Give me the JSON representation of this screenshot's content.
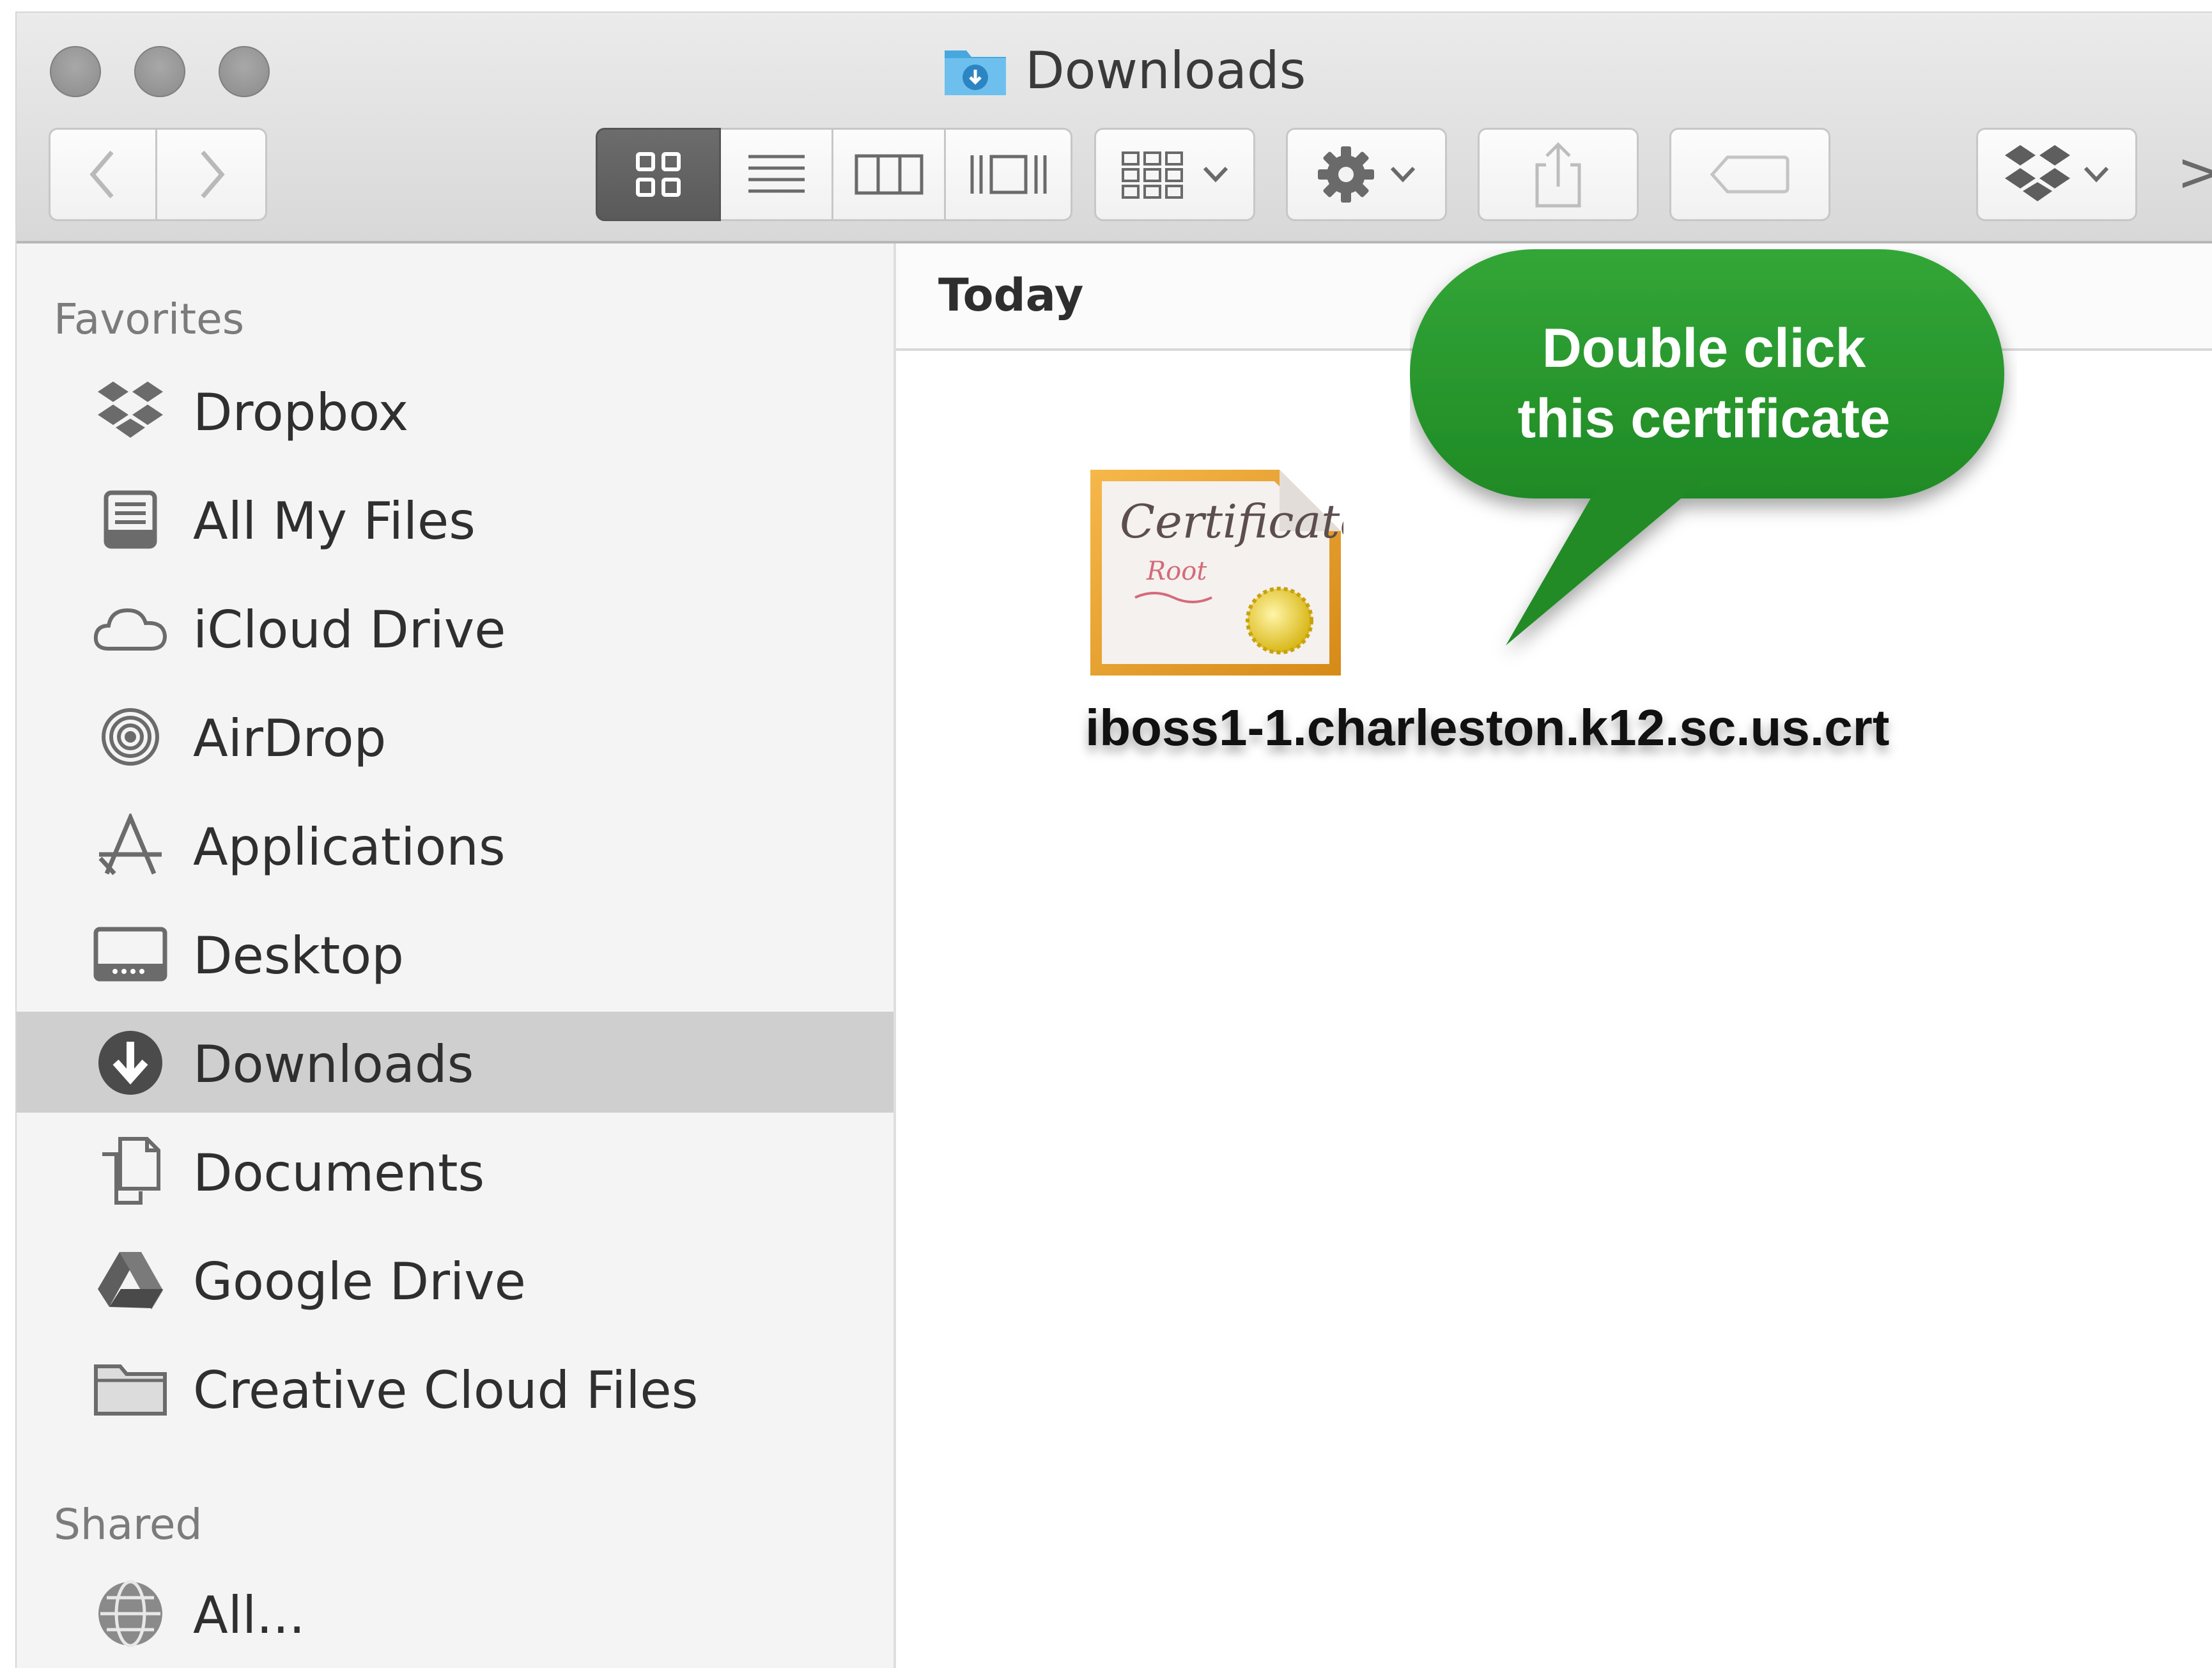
{
  "window": {
    "title": "Downloads"
  },
  "toolbar": {
    "back_icon": "chevron-left-icon",
    "forward_icon": "chevron-right-icon",
    "view_modes": [
      "icon-view",
      "list-view",
      "column-view",
      "cover-flow-view"
    ],
    "active_view": "icon-view",
    "overflow_label": ">>"
  },
  "sidebar": {
    "favorites_header": "Favorites",
    "favorites": [
      {
        "label": "Dropbox",
        "icon": "dropbox-icon"
      },
      {
        "label": "All My Files",
        "icon": "all-files-icon"
      },
      {
        "label": "iCloud Drive",
        "icon": "cloud-icon"
      },
      {
        "label": "AirDrop",
        "icon": "airdrop-icon"
      },
      {
        "label": "Applications",
        "icon": "applications-icon"
      },
      {
        "label": "Desktop",
        "icon": "desktop-icon"
      },
      {
        "label": "Downloads",
        "icon": "downloads-icon",
        "selected": true
      },
      {
        "label": "Documents",
        "icon": "documents-icon"
      },
      {
        "label": "Google Drive",
        "icon": "google-drive-icon"
      },
      {
        "label": "Creative Cloud Files",
        "icon": "folder-icon"
      }
    ],
    "shared_header": "Shared",
    "shared": [
      {
        "label": "All...",
        "icon": "network-globe-icon"
      }
    ]
  },
  "content": {
    "group_label": "Today",
    "files": [
      {
        "name": "iboss1-1.charleston.k12.sc.us.crt",
        "icon": "certificate-icon"
      }
    ]
  },
  "callout": {
    "line1": "Double click",
    "line2": "this certificate",
    "color": "#2a9a2f"
  },
  "colors": {
    "selection": "#cfcfcf",
    "sidebar_bg": "#f4f4f4",
    "toolbar_bg": "#e2e2e2"
  }
}
